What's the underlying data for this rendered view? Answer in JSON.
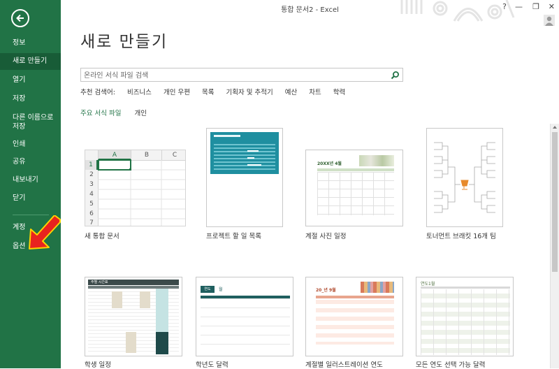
{
  "window": {
    "title": "통합 문서2 - Excel",
    "help": "?",
    "minimize": "—",
    "restore": "❐",
    "close": "✕"
  },
  "sidebar": {
    "items": [
      {
        "label": "정보"
      },
      {
        "label": "새로 만들기"
      },
      {
        "label": "열기"
      },
      {
        "label": "저장"
      },
      {
        "label": "다른 이름으로\n저장"
      },
      {
        "label": "인쇄"
      },
      {
        "label": "공유"
      },
      {
        "label": "내보내기"
      },
      {
        "label": "닫기"
      },
      {
        "label": "계정"
      },
      {
        "label": "옵션"
      }
    ],
    "active_index": 1,
    "bg_color": "#217346"
  },
  "main": {
    "page_title": "새로 만들기",
    "search": {
      "placeholder": "온라인 서식 파일 검색"
    },
    "suggest": {
      "label": "추천 검색어:",
      "items": [
        "비즈니스",
        "개인 우편",
        "목록",
        "기획자 및 추적기",
        "예산",
        "차트",
        "학력"
      ]
    },
    "tabs": {
      "featured": "주요 서식 파일",
      "personal": "개인"
    }
  },
  "templates": {
    "row1": [
      {
        "caption": "새 통합 문서",
        "columns": [
          "A",
          "B",
          "C"
        ],
        "rows": [
          "1",
          "2",
          "3",
          "4",
          "5",
          "6",
          "7"
        ]
      },
      {
        "caption": "프로젝트 할 일 목록"
      },
      {
        "caption": "계절 사진 일정",
        "heading": "20XX년 4월"
      },
      {
        "caption": "토너먼트 브래킷 16개 팀"
      }
    ],
    "row2": [
      {
        "caption": "학생 일정",
        "heading": "주별 시간표"
      },
      {
        "caption": "학년도 달력",
        "heading": "연도",
        "sub": "월"
      },
      {
        "caption": "계절별 일러스트레이션 연도",
        "heading": "20_년 9월"
      },
      {
        "caption": "모든 연도 선택 가능 달력",
        "heading": "연도1월"
      }
    ]
  }
}
